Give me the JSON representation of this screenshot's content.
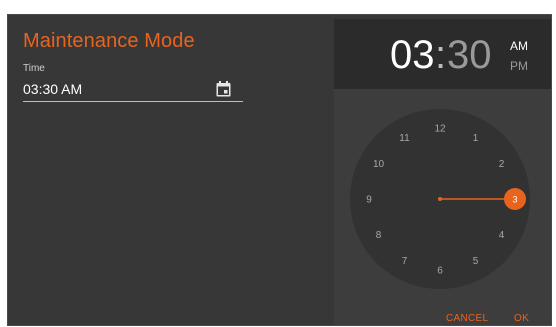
{
  "form": {
    "title": "Maintenance Mode",
    "time_label": "Time",
    "time_value": "03:30 AM"
  },
  "picker": {
    "hour": "03",
    "colon": ":",
    "minute": "30",
    "am_label": "AM",
    "pm_label": "PM",
    "selected_hour": "3",
    "clock_numbers": [
      "12",
      "1",
      "2",
      "3",
      "4",
      "5",
      "6",
      "7",
      "8",
      "9",
      "10",
      "11"
    ],
    "cancel_label": "CANCEL",
    "ok_label": "OK"
  },
  "colors": {
    "accent": "#e8641e",
    "panel": "#373737",
    "header": "#2b2b2b"
  },
  "icons": {
    "calendar": "calendar-icon"
  }
}
